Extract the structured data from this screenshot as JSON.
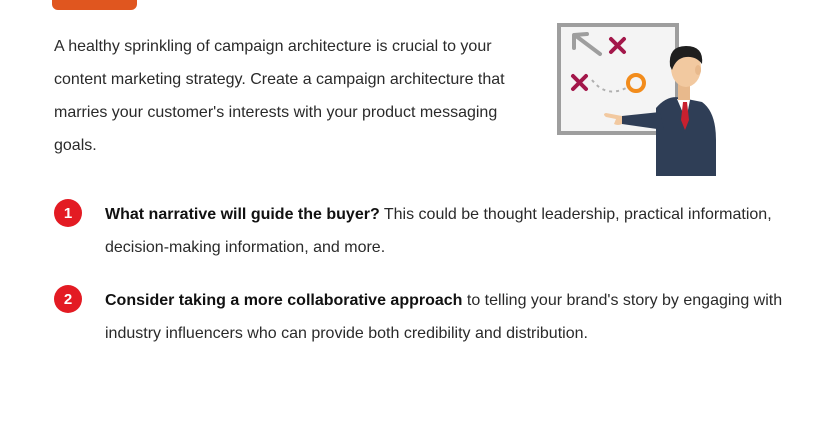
{
  "intro": {
    "text": "A healthy sprinkling of campaign architecture is crucial to your content marketing strategy. Create a campaign architecture that marries your customer's interests with your product messaging goals."
  },
  "illustration": {
    "icon": "strategy-whiteboard-presenter",
    "colors": {
      "board": "#f3f3f3",
      "frame": "#9e9e9e",
      "x_mark": "#a3174a",
      "o_mark": "#f28c1c",
      "arrow": "#9e9e9e",
      "suit": "#2f3e56",
      "tie": "#c8202f"
    }
  },
  "items": [
    {
      "number": "1",
      "bold": "What narrative will guide the buyer?",
      "text": " This could be thought leadership, practical information, decision-making information, and more."
    },
    {
      "number": "2",
      "bold": "Consider taking a more collaborative approach",
      "text": " to telling your brand's story by engaging with industry influencers who can provide both credibility and distribution."
    }
  ],
  "colors": {
    "accent_tab": "#e0561f",
    "badge": "#e31b23"
  }
}
